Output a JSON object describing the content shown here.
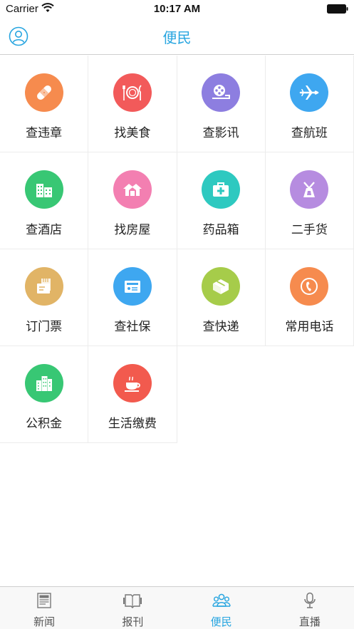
{
  "status_bar": {
    "carrier": "Carrier",
    "time": "10:17 AM"
  },
  "nav": {
    "title": "便民",
    "left_icon": "user-icon"
  },
  "colors": {
    "accent": "#27a5e0"
  },
  "grid": [
    {
      "label": "查违章",
      "icon": "bandage-icon",
      "color": "#f68b4e"
    },
    {
      "label": "找美食",
      "icon": "dining-icon",
      "color": "#f25a5a"
    },
    {
      "label": "查影讯",
      "icon": "film-reel-icon",
      "color": "#8d7ee0"
    },
    {
      "label": "查航班",
      "icon": "airplane-icon",
      "color": "#3ea7f0"
    },
    {
      "label": "查酒店",
      "icon": "hotel-building-icon",
      "color": "#38c774"
    },
    {
      "label": "找房屋",
      "icon": "house-icon",
      "color": "#f37fb1"
    },
    {
      "label": "药品箱",
      "icon": "medicine-box-icon",
      "color": "#2ec9c0"
    },
    {
      "label": "二手货",
      "icon": "gift-icon",
      "color": "#b68ce0"
    },
    {
      "label": "订门票",
      "icon": "ticket-icon",
      "color": "#e1b466"
    },
    {
      "label": "查社保",
      "icon": "id-card-icon",
      "color": "#3ea7f0"
    },
    {
      "label": "查快递",
      "icon": "package-icon",
      "color": "#a6cc4a"
    },
    {
      "label": "常用电话",
      "icon": "phone-icon",
      "color": "#f68b4e"
    },
    {
      "label": "公积金",
      "icon": "city-buildings-icon",
      "color": "#38c774"
    },
    {
      "label": "生活缴费",
      "icon": "coffee-cup-icon",
      "color": "#f25a4e"
    }
  ],
  "tabs": [
    {
      "label": "新闻",
      "icon": "newspaper-icon",
      "active": false
    },
    {
      "label": "报刊",
      "icon": "magazine-icon",
      "active": false
    },
    {
      "label": "便民",
      "icon": "people-icon",
      "active": true
    },
    {
      "label": "直播",
      "icon": "microphone-icon",
      "active": false
    }
  ]
}
